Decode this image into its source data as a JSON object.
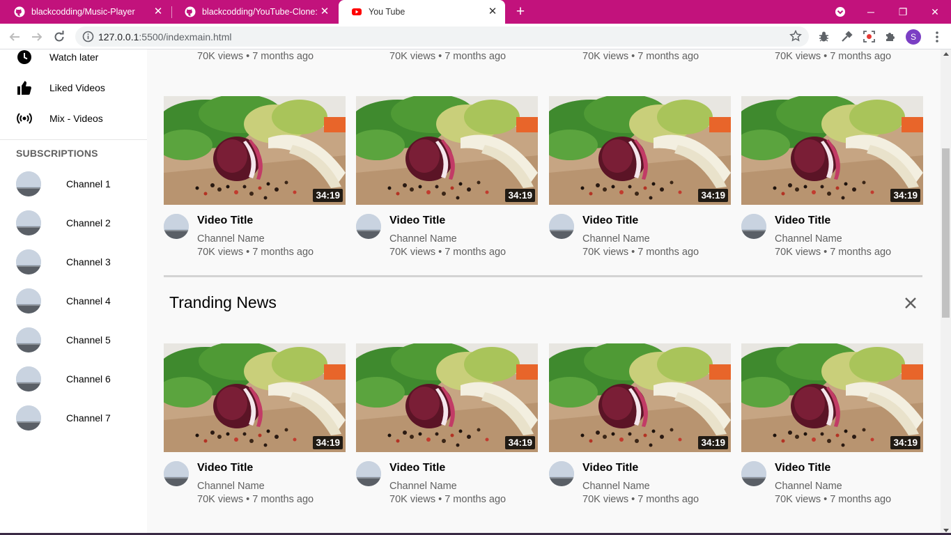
{
  "browser": {
    "tabs": [
      {
        "title": "blackcodding/Music-Player",
        "icon": "github-icon"
      },
      {
        "title": "blackcodding/YouTube-Clone: 🍁",
        "icon": "github-icon"
      },
      {
        "title": "You Tube",
        "icon": "youtube-icon",
        "active": true
      }
    ],
    "url_host": "127.0.0.1",
    "url_rest": ":5500/indexmain.html",
    "profile_initial": "S",
    "accent_color": "#c2127c"
  },
  "sidebar": {
    "items": [
      {
        "label": "Watch later",
        "icon": "clock-icon"
      },
      {
        "label": "Liked Videos",
        "icon": "thumbs-up-icon"
      },
      {
        "label": "Mix - Videos",
        "icon": "broadcast-icon"
      }
    ],
    "subscriptions_title": "SUBSCRIPTIONS",
    "channels": [
      "Channel 1",
      "Channel 2",
      "Channel 3",
      "Channel 4",
      "Channel 5",
      "Channel 6",
      "Channel 7"
    ]
  },
  "main": {
    "top_partial_meta": [
      "70K views • 7 months ago",
      "70K views • 7 months ago",
      "70K views • 7 months ago",
      "70K views • 7 months ago"
    ],
    "row1": [
      {
        "title": "Video Title",
        "channel": "Channel Name",
        "meta": "70K views • 7 months ago",
        "duration": "34:19"
      },
      {
        "title": "Video Title",
        "channel": "Channel Name",
        "meta": "70K views • 7 months ago",
        "duration": "34:19"
      },
      {
        "title": "Video Title",
        "channel": "Channel Name",
        "meta": "70K views • 7 months ago",
        "duration": "34:19"
      },
      {
        "title": "Video Title",
        "channel": "Channel Name",
        "meta": "70K views • 7 months ago",
        "duration": "34:19"
      }
    ],
    "section_title": "Tranding News",
    "row2": [
      {
        "title": "Video Title",
        "channel": "Channel Name",
        "meta": "70K views • 7 months ago",
        "duration": "34:19"
      },
      {
        "title": "Video Title",
        "channel": "Channel Name",
        "meta": "70K views • 7 months ago",
        "duration": "34:19"
      },
      {
        "title": "Video Title",
        "channel": "Channel Name",
        "meta": "70K views • 7 months ago",
        "duration": "34:19"
      },
      {
        "title": "Video Title",
        "channel": "Channel Name",
        "meta": "70K views • 7 months ago",
        "duration": "34:19"
      }
    ]
  }
}
